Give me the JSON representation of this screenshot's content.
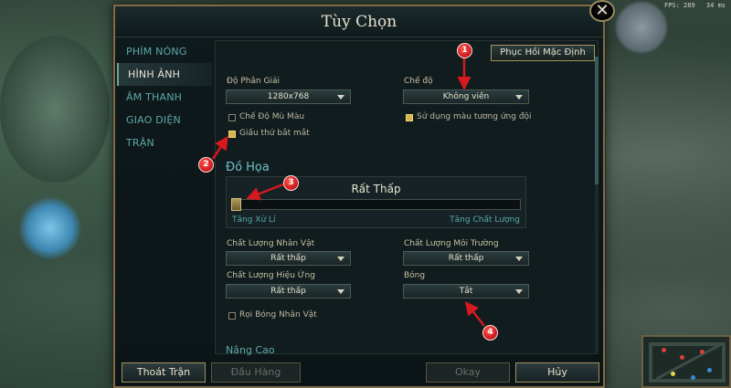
{
  "hud": {
    "fps": "FPS: 289",
    "ping": "34 ms"
  },
  "dialog": {
    "title": "Tùy Chọn",
    "close_symbol": "✕",
    "reset_label": "Phục Hồi Mặc Định"
  },
  "sidebar": {
    "items": [
      {
        "label": "PHÍM NÓNG",
        "active": false
      },
      {
        "label": "HÌNH ẢNH",
        "active": true
      },
      {
        "label": "ÂM THANH",
        "active": false
      },
      {
        "label": "GIAO DIỆN",
        "active": false
      },
      {
        "label": "TRẬN",
        "active": false
      }
    ]
  },
  "video": {
    "resolution": {
      "label": "Độ Phân Giải",
      "value": "1280x768"
    },
    "mode": {
      "label": "Chế độ",
      "value": "Không viền"
    },
    "colorblind": {
      "label": "Chế Độ Mù Màu",
      "checked": false
    },
    "team_colors": {
      "label": "Sử dụng màu tương ứng đội",
      "checked": true
    },
    "hide_eye_candy": {
      "label": "Giấu thứ bắt mắt",
      "checked": true
    }
  },
  "graphics": {
    "section_title": "Đồ Họa",
    "quality_value": "Rất Thấp",
    "quality_level": 0,
    "slider_min_label": "Tăng Xử Lí",
    "slider_max_label": "Tăng Chất Lượng",
    "character_quality": {
      "label": "Chất Lượng Nhân Vật",
      "value": "Rất thấp"
    },
    "environment_quality": {
      "label": "Chất Lượng Môi Trường",
      "value": "Rất thấp"
    },
    "effects_quality": {
      "label": "Chất Lượng Hiệu Ứng",
      "value": "Rất thấp"
    },
    "shadows": {
      "label": "Bóng",
      "value": "Tắt"
    },
    "character_inking": {
      "label": "Rọi Bóng Nhân Vật",
      "checked": false
    }
  },
  "advanced": {
    "section_title": "Nâng Cao"
  },
  "footer": {
    "exit_label": "Thoát Trận",
    "surrender_label": "Đầu Hàng",
    "okay_label": "Okay",
    "cancel_label": "Hủy"
  },
  "annotations": [
    "1",
    "2",
    "3",
    "4"
  ],
  "colors": {
    "accent_teal": "#5aa9a6",
    "gold_border": "#a4925e",
    "marker_red": "#d4191f"
  }
}
